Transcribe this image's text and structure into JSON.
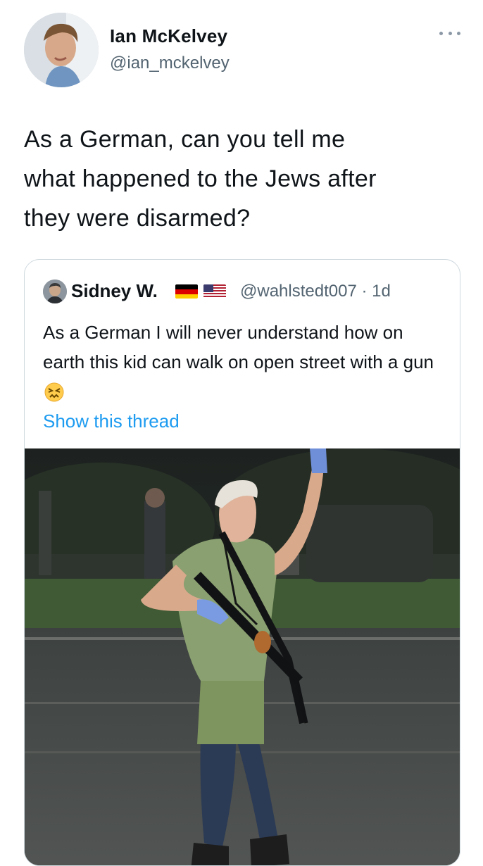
{
  "tweet": {
    "author_name": "Ian McKelvey",
    "author_handle": "@ian_mckelvey",
    "more_icon": "more-horizontal-icon",
    "text": "As a German, can you tell me\nwhat happened to the Jews after\nthey were disarmed?"
  },
  "quoted": {
    "author_name": "Sidney W.",
    "flags": [
      "german-flag-icon",
      "us-flag-icon"
    ],
    "handle_time": "@wahlstedt007 · 1d",
    "text": "As a German I will never understand how on earth this kid can walk on open street with a gun",
    "emoji": "confounded-face-emoji",
    "show_thread": "Show this thread"
  },
  "colors": {
    "link": "#1d9bf0",
    "secondary_text": "#536471",
    "border": "#cfd9de"
  }
}
